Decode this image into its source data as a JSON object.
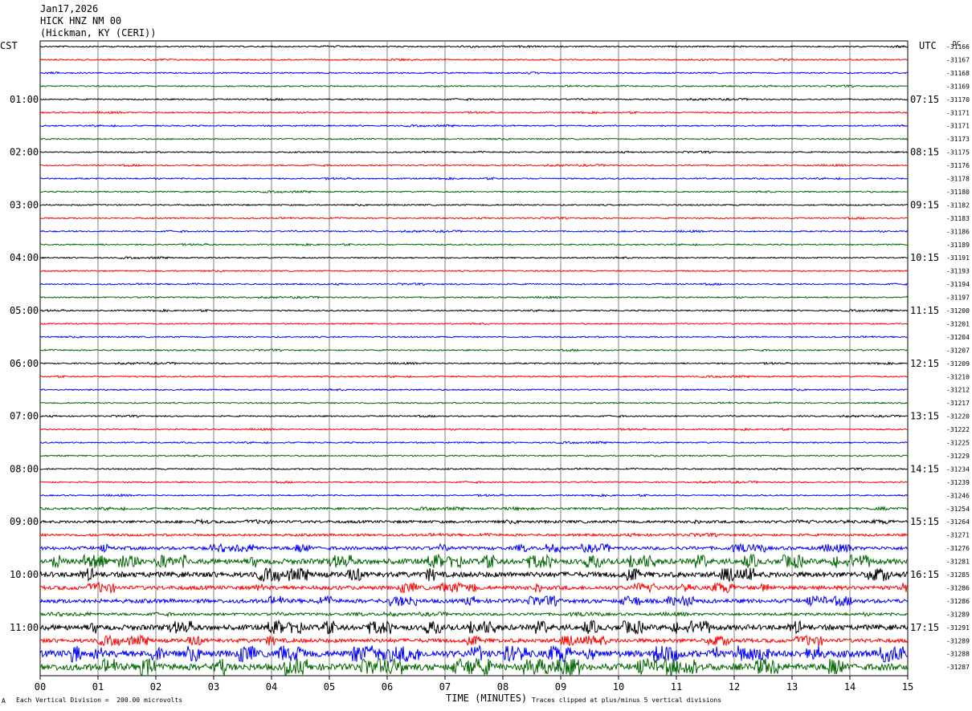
{
  "header": {
    "date": "Jan17,2026",
    "station": "HICK HNZ NM 00",
    "location": "(Hickman, KY (CERI))"
  },
  "left_tz": "CST",
  "right_tz": "UTC",
  "dc_label": "DC",
  "xlabel": "TIME (MINUTES)",
  "footer": {
    "scale": "Each Vertical Division =  200.00 microvolts",
    "clip": "Traces clipped at plus/minus 5 vertical divisions",
    "mark": "A"
  },
  "chart_data": {
    "type": "line",
    "title": "HICK HNZ NM 00",
    "xlim": [
      0,
      15
    ],
    "x_ticks": [
      "00",
      "01",
      "02",
      "03",
      "04",
      "05",
      "06",
      "07",
      "08",
      "09",
      "10",
      "11",
      "12",
      "13",
      "14",
      "15"
    ],
    "trace_colors": [
      "#000000",
      "#ff0000",
      "#0000ff",
      "#006600"
    ],
    "left_labels": [
      {
        "row": 4,
        "text": "01:00"
      },
      {
        "row": 8,
        "text": "02:00"
      },
      {
        "row": 12,
        "text": "03:00"
      },
      {
        "row": 16,
        "text": "04:00"
      },
      {
        "row": 20,
        "text": "05:00"
      },
      {
        "row": 24,
        "text": "06:00"
      },
      {
        "row": 28,
        "text": "07:00"
      },
      {
        "row": 32,
        "text": "08:00"
      },
      {
        "row": 36,
        "text": "09:00"
      },
      {
        "row": 40,
        "text": "10:00"
      },
      {
        "row": 44,
        "text": "11:00"
      }
    ],
    "right_labels": [
      {
        "row": 4,
        "text": "07:15"
      },
      {
        "row": 8,
        "text": "08:15"
      },
      {
        "row": 12,
        "text": "09:15"
      },
      {
        "row": 16,
        "text": "10:15"
      },
      {
        "row": 20,
        "text": "11:15"
      },
      {
        "row": 24,
        "text": "12:15"
      },
      {
        "row": 28,
        "text": "13:15"
      },
      {
        "row": 32,
        "text": "14:15"
      },
      {
        "row": 36,
        "text": "15:15"
      },
      {
        "row": 40,
        "text": "16:15"
      },
      {
        "row": 44,
        "text": "17:15"
      }
    ],
    "dc_offsets": [
      "-31166",
      "-31167",
      "-31168",
      "-31169",
      "-31170",
      "-31171",
      "-31171",
      "-31173",
      "-31175",
      "-31176",
      "-31178",
      "-31180",
      "-31182",
      "-31183",
      "-31186",
      "-31189",
      "-31191",
      "-31193",
      "-31194",
      "-31197",
      "-31200",
      "-31201",
      "-31204",
      "-31207",
      "-31209",
      "-31210",
      "-31212",
      "-31217",
      "-31220",
      "-31222",
      "-31225",
      "-31229",
      "-31234",
      "-31239",
      "-31246",
      "-31254",
      "-31264",
      "-31271",
      "-31276",
      "-31281",
      "-31285",
      "-31286",
      "-31286",
      "-31289",
      "-31291",
      "-31289",
      "-31288",
      "-31287"
    ],
    "trace_activity": [
      1,
      1,
      1,
      1,
      1,
      1,
      1,
      1,
      1,
      1,
      1,
      1,
      1,
      1,
      1,
      1,
      1,
      1,
      1,
      1,
      1,
      1,
      1,
      1,
      1,
      1,
      1,
      1,
      1,
      1,
      1,
      1,
      1,
      1,
      1,
      1.6,
      2,
      1.8,
      2.5,
      4,
      4,
      3,
      3,
      2,
      4,
      3,
      5,
      5
    ]
  }
}
